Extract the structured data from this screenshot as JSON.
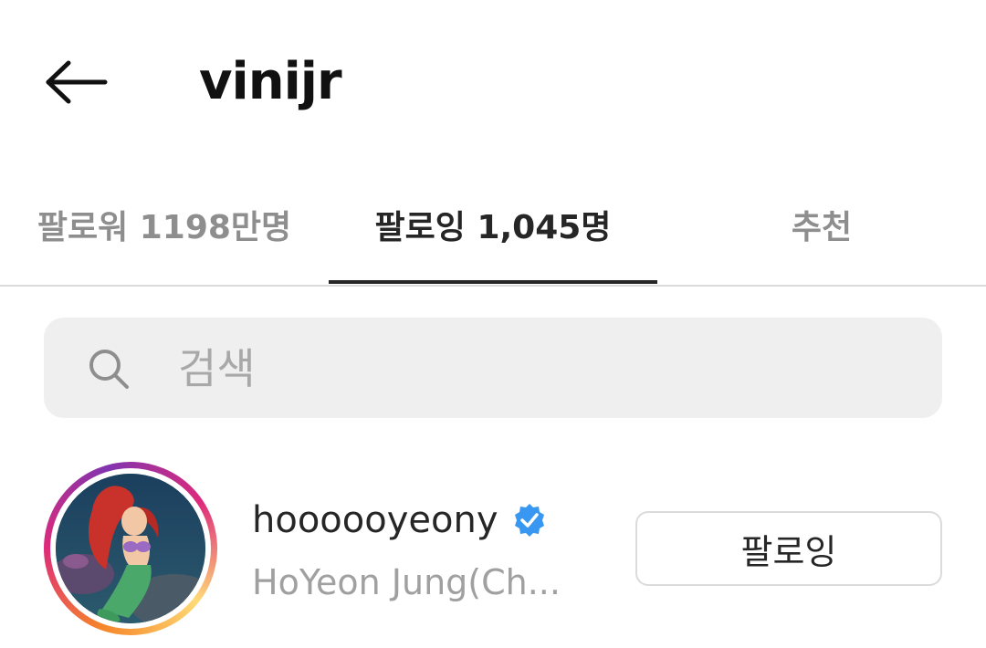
{
  "header": {
    "title": "vinijr",
    "back_icon": "arrow-left-icon"
  },
  "tabs": [
    {
      "label": "팔로워 1198만명",
      "active": false
    },
    {
      "label": "팔로잉 1,045명",
      "active": true
    },
    {
      "label": "추천",
      "active": false
    }
  ],
  "search": {
    "placeholder": "검색",
    "value": "",
    "icon": "search-icon"
  },
  "following_list": [
    {
      "username": "hoooooyeony",
      "verified": true,
      "full_name": "HoYeon Jung(Ch...",
      "button_label": "팔로잉",
      "avatar_icon": "mermaid-avatar"
    }
  ],
  "colors": {
    "text_primary": "#262626",
    "text_secondary": "#8e8e8e",
    "divider": "#dbdbdb",
    "search_bg": "#efefef",
    "verified_blue": "#3897f0"
  }
}
